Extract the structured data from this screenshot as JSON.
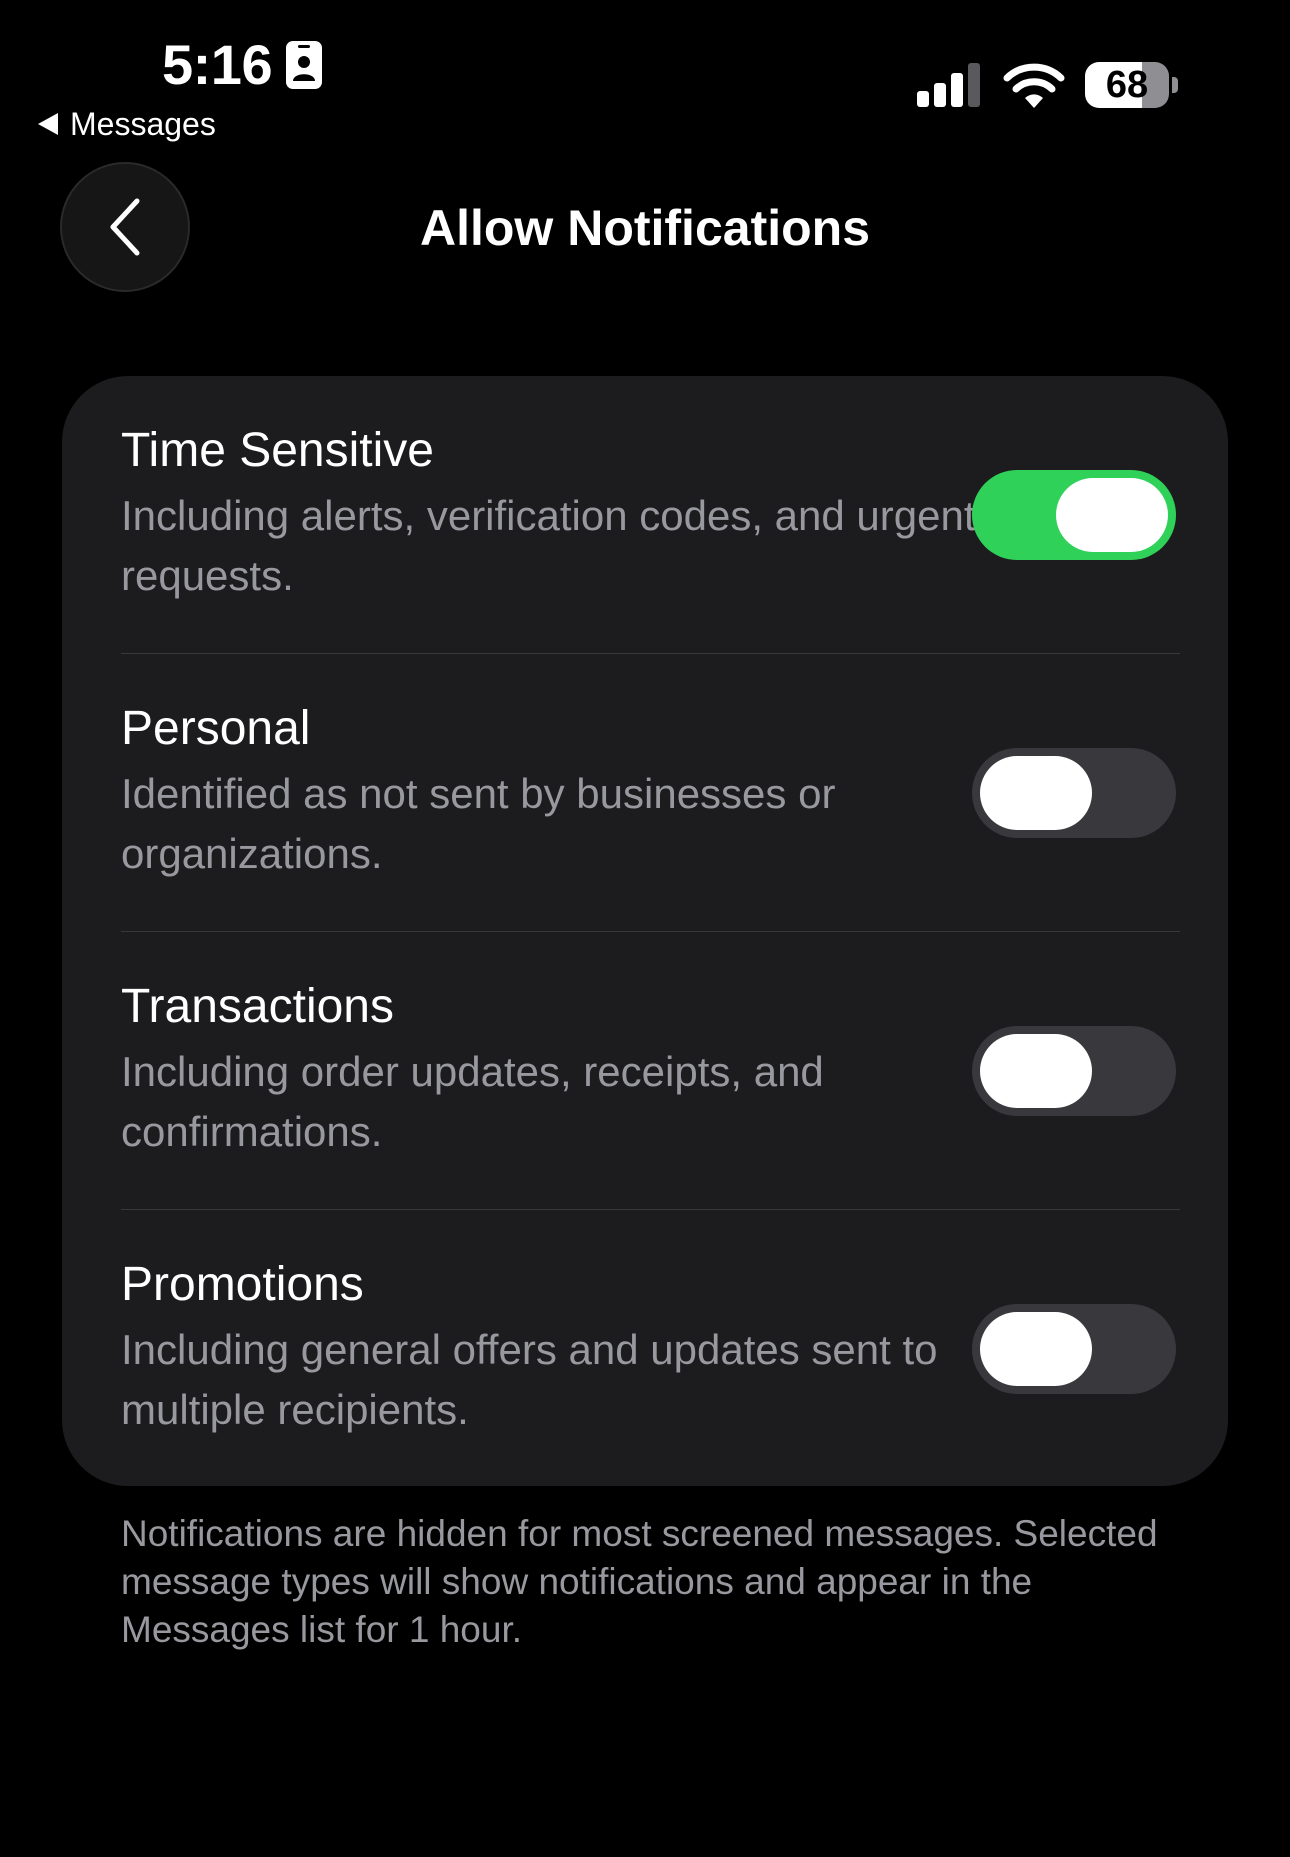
{
  "status_bar": {
    "time": "5:16",
    "time_badge_icon": "id-badge-icon",
    "back_app_label": "Messages",
    "battery_level": "68",
    "battery_fraction": 0.68,
    "signal_bars_active": 3,
    "signal_bars_total": 4
  },
  "nav": {
    "back_icon": "chevron-left-icon",
    "title": "Allow Notifications"
  },
  "settings": [
    {
      "key": "time_sensitive",
      "title": "Time Sensitive",
      "description": "Including alerts, verification codes, and urgent requests.",
      "enabled": true
    },
    {
      "key": "personal",
      "title": "Personal",
      "description": "Identified as not sent by businesses or organizations.",
      "enabled": false
    },
    {
      "key": "transactions",
      "title": "Transactions",
      "description": "Including order updates, receipts, and confirmations.",
      "enabled": false
    },
    {
      "key": "promotions",
      "title": "Promotions",
      "description": "Including general offers and updates sent to multiple recipients.",
      "enabled": false
    }
  ],
  "footer": {
    "note": "Notifications are hidden for most screened messages. Selected message types will show notifications and appear in the Messages list for 1 hour."
  },
  "colors": {
    "background": "#000000",
    "card": "#1c1c1e",
    "toggle_on": "#30d158",
    "toggle_off": "#39393d",
    "secondary_text": "#98989f"
  }
}
